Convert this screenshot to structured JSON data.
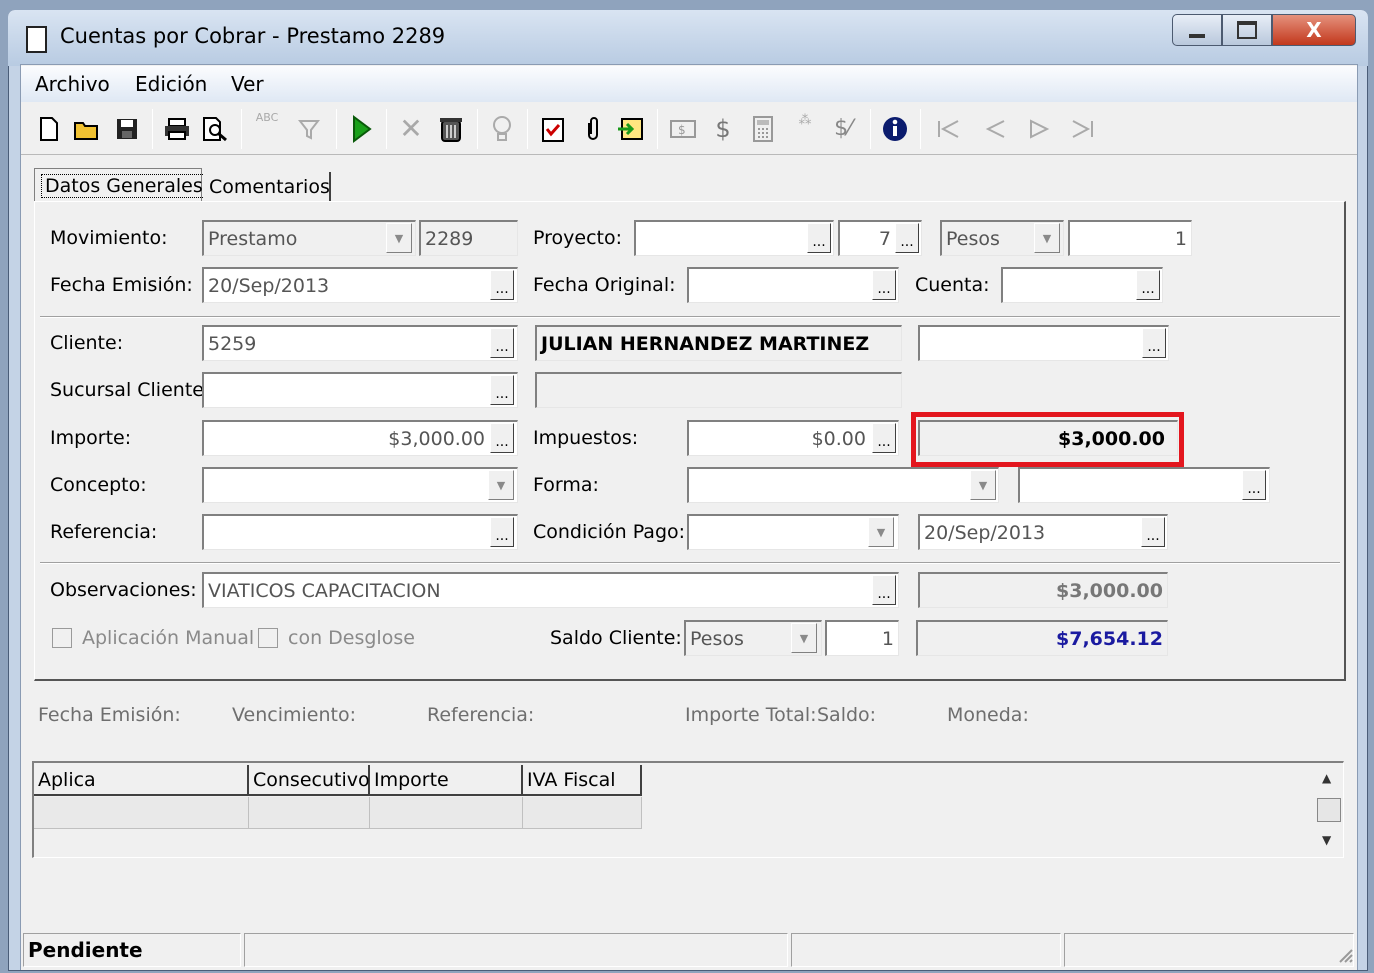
{
  "window": {
    "title": "Cuentas por Cobrar - Prestamo 2289",
    "close_glyph": "X"
  },
  "menu": [
    "Archivo",
    "Edición",
    "Ver"
  ],
  "toolbar": {
    "abc_label": "ABC",
    "icons": [
      "new-document-icon",
      "open-folder-icon",
      "save-icon",
      "print-icon",
      "print-preview-icon",
      "spell-check-icon",
      "filter-icon",
      "play-icon",
      "cancel-icon",
      "delete-icon",
      "lightbulb-icon",
      "clipboard-check-icon",
      "paperclip-icon",
      "import-icon",
      "money-bill-icon",
      "dollar-icon",
      "calculator-icon",
      "stars-icon",
      "dollar-percent-icon",
      "info-icon",
      "first-record-icon",
      "previous-record-icon",
      "next-record-icon",
      "last-record-icon"
    ]
  },
  "tabs": {
    "general": "Datos Generales",
    "comentarios": "Comentarios"
  },
  "form": {
    "movimiento_label": "Movimiento:",
    "movimiento_value": "Prestamo",
    "movimiento_num": "2289",
    "proyecto_label": "Proyecto:",
    "proyecto_value": "",
    "proyecto_num": "7",
    "moneda_value": "Pesos",
    "tipo_cambio": "1",
    "fecha_emision_label": "Fecha Emisión:",
    "fecha_emision_value": "20/Sep/2013",
    "fecha_original_label": "Fecha Original:",
    "fecha_original_value": "",
    "cuenta_label": "Cuenta:",
    "cuenta_value": "",
    "cliente_label": "Cliente:",
    "cliente_value": "5259",
    "cliente_nombre": "JULIAN HERNANDEZ MARTINEZ",
    "cliente_extra": "",
    "sucursal_label": "Sucursal Cliente:",
    "sucursal_value": "",
    "importe_label": "Importe:",
    "importe_value": "$3,000.00",
    "impuestos_label": "Impuestos:",
    "impuestos_value": "$0.00",
    "total_value": "$3,000.00",
    "concepto_label": "Concepto:",
    "forma_label": "Forma:",
    "referencia_label": "Referencia:",
    "condicion_label": "Condición Pago:",
    "vencimiento_value": "20/Sep/2013",
    "observaciones_label": "Observaciones:",
    "observaciones_value": "VIATICOS CAPACITACION",
    "observaciones_total": "$3,000.00",
    "aplicacion_manual_label": "Aplicación Manual",
    "con_desglose_label": "con Desglose",
    "saldo_cliente_label": "Saldo Cliente:",
    "saldo_moneda": "Pesos",
    "saldo_tc": "1",
    "saldo_value": "$7,654.12",
    "saldo_color": "#1a1aa0",
    "highlight_color": "#e3161e"
  },
  "detail_headers": [
    "Fecha Emisión:",
    "Vencimiento:",
    "Referencia:",
    "Importe Total:",
    "Saldo:",
    "Moneda:"
  ],
  "grid_columns": [
    "Aplica",
    "Consecutivo",
    "Importe",
    "IVA Fiscal"
  ],
  "status": {
    "state": "Pendiente"
  }
}
